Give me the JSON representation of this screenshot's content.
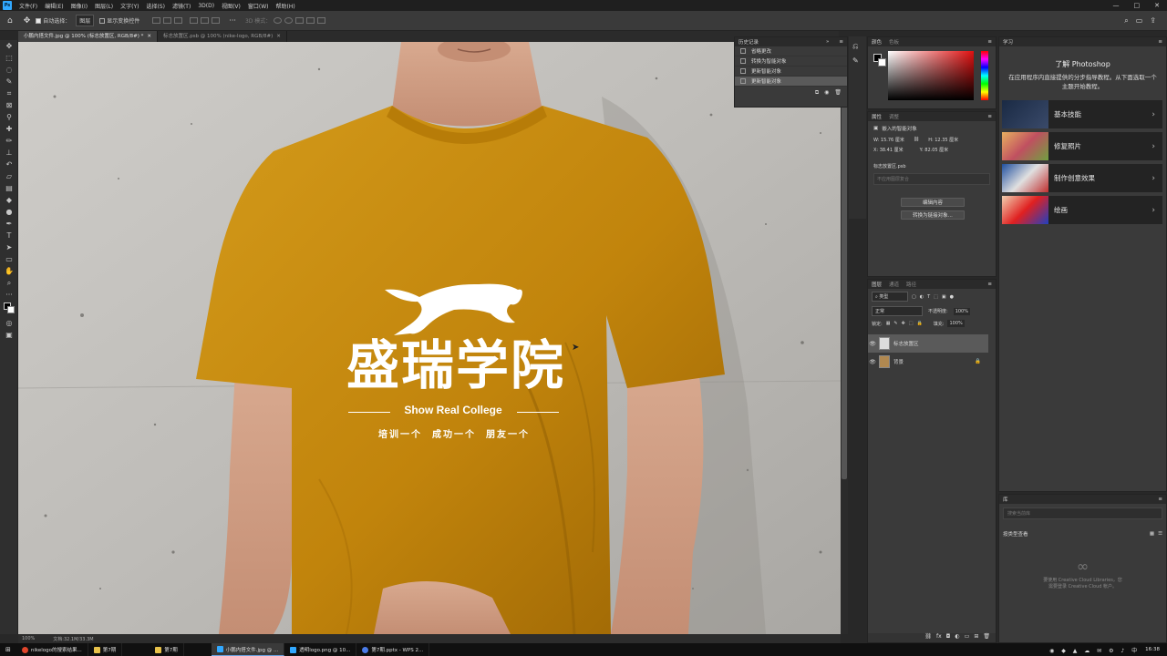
{
  "menu": [
    "文件(F)",
    "编辑(E)",
    "图像(I)",
    "图层(L)",
    "文字(Y)",
    "选择(S)",
    "滤镜(T)",
    "3D(D)",
    "视图(V)",
    "窗口(W)",
    "帮助(H)"
  ],
  "options": {
    "auto_select": "自动选择：",
    "layer_select": "图层",
    "show_transform": "显示变换控件",
    "mode_3d": "3D 模式："
  },
  "tabs": [
    {
      "label": "小鹏内搭文件.jpg @ 100% (标志放置区, RGB/8#) *"
    },
    {
      "label": "标志放置区.psb @ 100% (nike-logo, RGB/8#)"
    }
  ],
  "canvas": {
    "logo_cn": "盛瑞学院",
    "logo_en": "Show Real College",
    "slogan": "培训一个  成功一个  朋友一个"
  },
  "status": {
    "zoom": "100%",
    "doc": "文档:32.1M/33.3M"
  },
  "history": {
    "title": "历史记录",
    "items": [
      {
        "label": "省略更改",
        "selected": false
      },
      {
        "label": "转换为智能对象",
        "selected": false
      },
      {
        "label": "更新智能对象",
        "selected": false
      },
      {
        "label": "更新智能对象",
        "selected": true
      }
    ]
  },
  "color_panel": {
    "tab1": "颜色",
    "tab2": "色板"
  },
  "properties": {
    "tab1": "属性",
    "tab2": "调整",
    "type": "嵌入的智能对象",
    "w": "W: 15.76 厘米",
    "h": "H: 12.35 厘米",
    "x": "X: 38.41 厘米",
    "y": "Y: 82.05 厘米",
    "file": "标志放置区.psb",
    "comp": "不应用图层复合",
    "edit_btn": "编辑内容",
    "convert_btn": "转换为链接对象..."
  },
  "layers": {
    "tab1": "图层",
    "tab2": "通道",
    "tab3": "路径",
    "filter": "类型",
    "blend": "正常",
    "opacity_label": "不透明度:",
    "opacity": "100%",
    "lock_label": "锁定:",
    "fill_label": "填充:",
    "fill": "100%",
    "items": [
      {
        "name": "标志放置区",
        "selected": true
      },
      {
        "name": "背景",
        "selected": false
      }
    ]
  },
  "learn": {
    "tab": "学习",
    "title": "了解 Photoshop",
    "desc": "在应用程序内直接提供的分步指导教程。从下面选取一个主题开始教程。",
    "cards": [
      "基本技能",
      "修复照片",
      "制作创意效果",
      "绘画"
    ]
  },
  "libraries": {
    "tab": "库",
    "search_placeholder": "搜索当前库",
    "view": "按类型查看",
    "cc_msg1": "要使用 Creative Cloud Libraries，您",
    "cc_msg2": "需要登录 Creative Cloud 帐户。"
  },
  "taskbar": {
    "items": [
      {
        "label": "nikelogo的搜索结果...",
        "color": "#e0452b"
      },
      {
        "label": "第7期",
        "color": "#e8c24a"
      },
      {
        "label": "第7期",
        "color": "#e8c24a"
      },
      {
        "label": "小鹏内搭文件.jpg @ ...",
        "color": "#31a8ff"
      },
      {
        "label": "透明logo.png @ 10...",
        "color": "#31a8ff"
      },
      {
        "label": "第7期.pptx - WPS 2...",
        "color": "#4a7be8"
      }
    ],
    "time": "16:38"
  },
  "colors": {
    "accent": "#31a8ff",
    "shirt": "#c98a10",
    "wall": "#c4c2be"
  }
}
